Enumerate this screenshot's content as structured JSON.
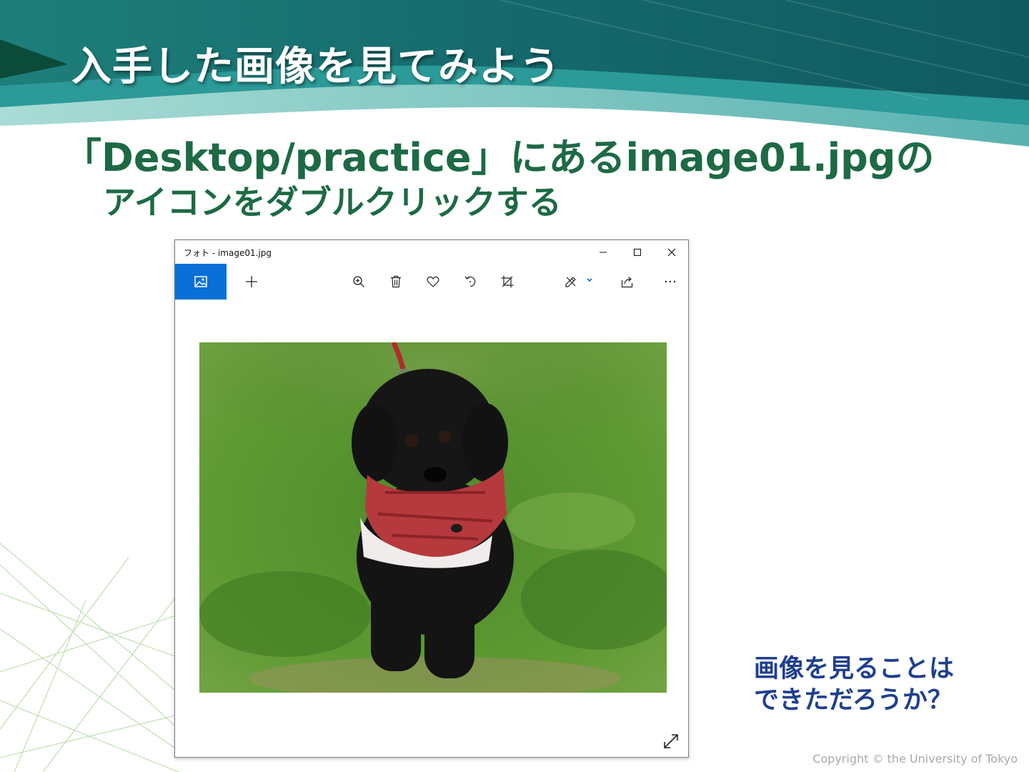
{
  "slide": {
    "title": "入手した画像を見てみよう",
    "instruction_line1": "「Desktop/practice」にあるimage01.jpgの",
    "instruction_line2": "アイコンをダブルクリックする",
    "note_line1": "画像を見ることは",
    "note_line2": "できただろうか？",
    "copyright": "Copyright © the University of Tokyo"
  },
  "window": {
    "title": "フォト - image01.jpg",
    "controls": [
      "minimize-icon",
      "maximize-icon",
      "close-icon"
    ],
    "toolbar": [
      "photo-collection-icon",
      "add-icon",
      "zoom-icon",
      "delete-icon",
      "favorite-icon",
      "rotate-icon",
      "crop-icon",
      "edit-draw-icon",
      "share-icon",
      "more-icon"
    ],
    "accent_color": "#0a6fd6"
  },
  "colors": {
    "title_text": "#ffffff",
    "instruction_text": "#1d6a45",
    "note_text": "#1f3f8f",
    "banner_dark": "#0f5f63",
    "banner_light": "#7cc6c0"
  }
}
